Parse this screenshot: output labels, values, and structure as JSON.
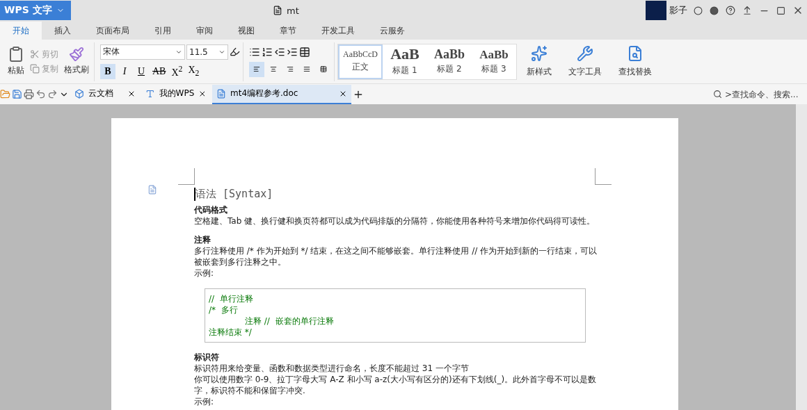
{
  "app_button": {
    "label": "WPS 文字"
  },
  "window": {
    "title": "mt"
  },
  "user": {
    "name": "影子"
  },
  "ribbon_tabs": [
    {
      "label": "开始",
      "selected": true
    },
    {
      "label": "插入",
      "selected": false
    },
    {
      "label": "页面布局",
      "selected": false
    },
    {
      "label": "引用",
      "selected": false
    },
    {
      "label": "审阅",
      "selected": false
    },
    {
      "label": "视图",
      "selected": false
    },
    {
      "label": "章节",
      "selected": false
    },
    {
      "label": "开发工具",
      "selected": false
    },
    {
      "label": "云服务",
      "selected": false
    }
  ],
  "clipboard": {
    "paste": "粘贴",
    "cut": "剪切",
    "copy": "复制",
    "format_painter": "格式刷"
  },
  "font": {
    "name": "宋体",
    "size": "11.5"
  },
  "format_buttons": [
    {
      "kind": "bold",
      "label": "B",
      "active": true
    },
    {
      "kind": "italic",
      "label": "I",
      "active": false
    },
    {
      "kind": "underline",
      "label": "U",
      "active": false
    },
    {
      "kind": "strike",
      "label": "AB",
      "active": false
    },
    {
      "kind": "plain",
      "label": "X$^{2}$",
      "active": false
    },
    {
      "kind": "plain",
      "label": "X$_{2}$",
      "active": false
    }
  ],
  "alignments": [
    {
      "kind": "left",
      "selected": true
    },
    {
      "kind": "center",
      "selected": false
    },
    {
      "kind": "right",
      "selected": false
    },
    {
      "kind": "justify",
      "selected": false
    },
    {
      "kind": "distributed",
      "selected": false
    }
  ],
  "styles": [
    {
      "preview": "AaBbCcD",
      "label": "正文",
      "kind": "normal",
      "selected": true
    },
    {
      "preview": "AaB",
      "label": "标题 1",
      "kind": "h1",
      "selected": false
    },
    {
      "preview": "AaBb",
      "label": "标题 2",
      "kind": "h2",
      "selected": false
    },
    {
      "preview": "AaBb",
      "label": "标题 3",
      "kind": "h3",
      "selected": false
    }
  ],
  "tools": [
    {
      "label": "新样式",
      "kind": "new-style"
    },
    {
      "label": "文字工具",
      "kind": "text-tools"
    },
    {
      "label": "查找替换",
      "kind": "find"
    }
  ],
  "doc_tabs": [
    {
      "label": "云文档",
      "kind": "cloud",
      "selected": false
    },
    {
      "label": "我的WPS",
      "kind": "wps",
      "selected": false
    },
    {
      "label": "mt4编程参考.doc",
      "kind": "doc",
      "selected": true
    }
  ],
  "search": {
    "placeholder": ">查找命令、搜索..."
  },
  "document": {
    "blocks": [
      {
        "kind": "title",
        "text": "语法 [Syntax]"
      },
      {
        "kind": "heading",
        "text": "代码格式"
      },
      {
        "kind": "paragraph",
        "text": "空格建、Tab 健、换行健和换页符都可以成为代码排版的分隔符，你能使用各种符号来增加你代码得可读性。"
      },
      {
        "kind": "heading",
        "text": "注释"
      },
      {
        "kind": "paragraph",
        "text": "多行注释使用 /* 作为开始到 */ 结束，在这之间不能够嵌套。单行注释使用 // 作为开始到新的一行结束，可以被嵌套到多行注释之中。"
      },
      {
        "kind": "paragraph",
        "text": "示例:"
      },
      {
        "kind": "code",
        "lines": [
          {
            "text": "//  单行注释",
            "indented": false
          },
          {
            "text": "/*  多行",
            "indented": false
          },
          {
            "text": "注释 //  嵌套的单行注释",
            "indented": true
          },
          {
            "text": "注释结束 */",
            "indented": false
          }
        ]
      },
      {
        "kind": "heading",
        "text": "标识符"
      },
      {
        "kind": "paragraph",
        "text": "标识符用来给变量、函数和数据类型进行命名，长度不能超过 31 一个字节"
      },
      {
        "kind": "paragraph",
        "text": "你可以使用数字 0-9、拉丁字母大写 A-Z 和小写 a-z(大小写有区分的)还有下划线(_)。此外首字母不可以是数字，标识符不能和保留字冲突."
      },
      {
        "kind": "paragraph",
        "text": "示例:"
      }
    ]
  }
}
